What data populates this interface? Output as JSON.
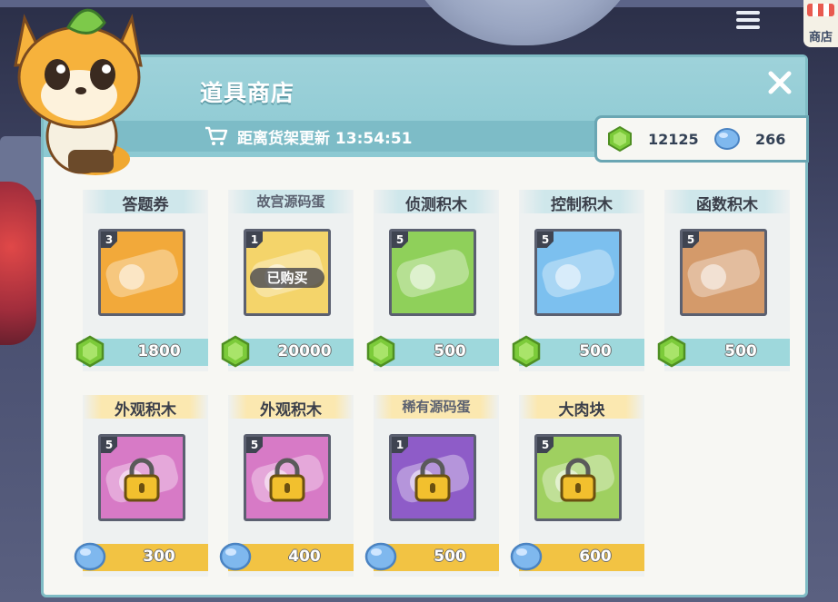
{
  "corner_shop": {
    "label": "商店"
  },
  "shop": {
    "title": "道具商店",
    "timer_label": "距离货架更新",
    "timer_value": "13:54:51",
    "currency": {
      "green_amount": "12125",
      "blue_amount": "266"
    }
  },
  "items": [
    {
      "name": "答题券",
      "count": "3",
      "price": "1800",
      "currency": "green",
      "color": "#f2a93a",
      "icon": "ticket-card"
    },
    {
      "name": "故宫源码蛋",
      "count": "1",
      "price": "20000",
      "currency": "green",
      "color": "#f4d46a",
      "icon": "egg",
      "status": "已购买"
    },
    {
      "name": "侦测积木",
      "count": "5",
      "price": "500",
      "currency": "green",
      "color": "#8fd05a",
      "icon": "sensing-block"
    },
    {
      "name": "控制积木",
      "count": "5",
      "price": "500",
      "currency": "green",
      "color": "#7cc0ef",
      "icon": "control-block"
    },
    {
      "name": "函数积木",
      "count": "5",
      "price": "500",
      "currency": "green",
      "color": "#d49a6a",
      "icon": "procedure-block"
    },
    {
      "name": "外观积木",
      "count": "5",
      "price": "300",
      "currency": "blue",
      "color": "#d77ac6",
      "icon": "looks-block-locked"
    },
    {
      "name": "外观积木",
      "count": "5",
      "price": "400",
      "currency": "blue",
      "color": "#d77ac6",
      "icon": "looks-block-locked"
    },
    {
      "name": "稀有源码蛋",
      "count": "1",
      "price": "500",
      "currency": "blue",
      "color": "#8e5cc8",
      "icon": "rare-egg-locked"
    },
    {
      "name": "大肉块",
      "count": "5",
      "price": "600",
      "currency": "blue",
      "color": "#9fd060",
      "icon": "meat-locked"
    }
  ]
}
